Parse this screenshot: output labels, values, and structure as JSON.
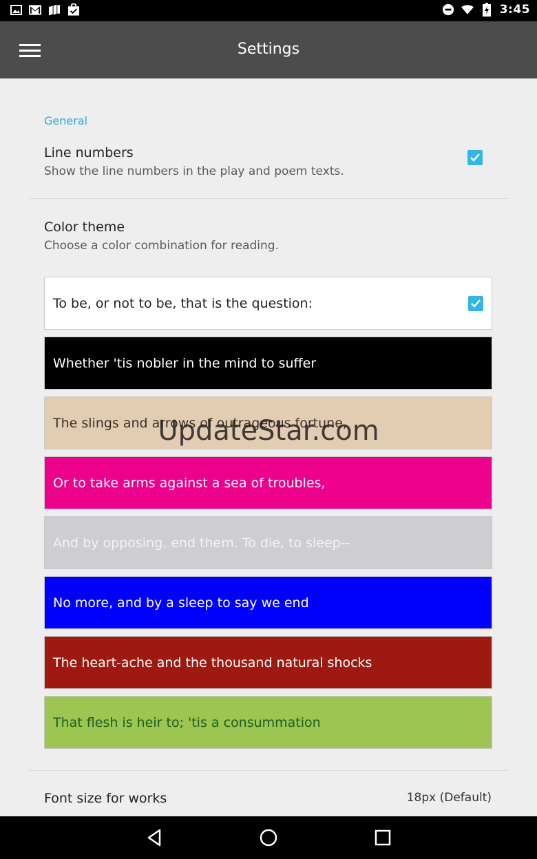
{
  "status_bar": {
    "time": "3:45",
    "left_icons": [
      "image-icon",
      "gmail-icon",
      "books-icon",
      "store-icon"
    ],
    "right_icons": [
      "do-not-disturb-icon",
      "wifi-icon",
      "battery-icon"
    ]
  },
  "app_bar": {
    "title": "Settings",
    "menu_icon": "hamburger-menu-icon"
  },
  "general": {
    "header": "General",
    "line_numbers": {
      "title": "Line numbers",
      "summary": "Show the line numbers in the play and poem texts.",
      "checked": true
    },
    "color_theme": {
      "title": "Color theme",
      "summary": "Choose a color combination for reading."
    },
    "themes": [
      {
        "text": "To be, or not to be, that is the question:",
        "bg": "#ffffff",
        "fg": "#212121",
        "selected": true
      },
      {
        "text": "Whether 'tis nobler in the mind to suffer",
        "bg": "#000000",
        "fg": "#ffffff",
        "selected": false
      },
      {
        "text": "The slings and arrows of outrageous fortune,",
        "bg": "#e3cdb2",
        "fg": "#3a2f25",
        "selected": false
      },
      {
        "text": "Or to take arms against a sea of troubles,",
        "bg": "#ec008c",
        "fg": "#ffffff",
        "selected": false
      },
      {
        "text": "And by opposing, end them. To die, to sleep--",
        "bg": "#cdcdd2",
        "fg": "#f4f4f4",
        "selected": false
      },
      {
        "text": "No more, and by a sleep to say we end",
        "bg": "#0000ff",
        "fg": "#ffffff",
        "selected": false
      },
      {
        "text": "The heart-ache and the thousand natural shocks",
        "bg": "#9e1a10",
        "fg": "#ffffff",
        "selected": false
      },
      {
        "text": "That flesh is heir to; 'tis a consummation",
        "bg": "#9dc551",
        "fg": "#1b5e20",
        "selected": false
      }
    ],
    "font_size": {
      "title": "Font size for works",
      "value": "18px (Default)"
    }
  },
  "watermark": "UpdateStar.com",
  "nav_bar": {
    "buttons": [
      "back-icon",
      "home-icon",
      "recents-icon"
    ]
  },
  "colors": {
    "accent": "#33b5e5",
    "section_header": "#33a8df",
    "app_bar": "#4c4c4c"
  }
}
